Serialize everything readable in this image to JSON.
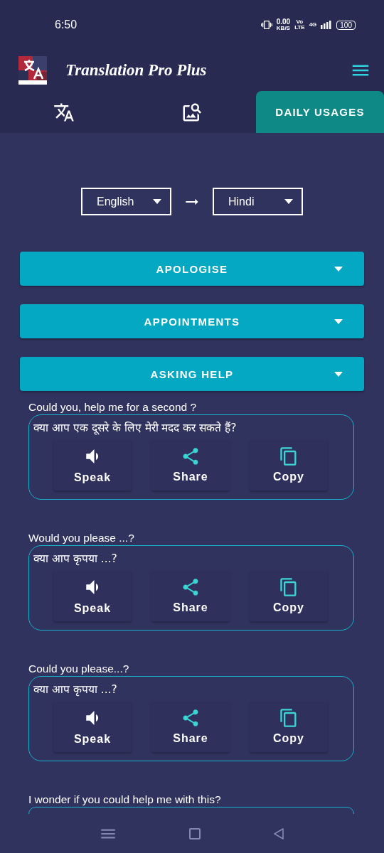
{
  "status_bar": {
    "time": "6:50",
    "speed": "0.00",
    "speed_unit": "KB/S",
    "volte_top": "Vo",
    "volte_bottom": "LTE",
    "network": "4G",
    "battery": "100"
  },
  "app_bar": {
    "title": "Translation Pro Plus"
  },
  "tabs": [
    {
      "kind": "translate",
      "selected": false
    },
    {
      "kind": "image-search",
      "selected": false
    },
    {
      "kind": "text",
      "label": "DAILY USAGES",
      "selected": true
    }
  ],
  "languages": {
    "source": "English",
    "target": "Hindi"
  },
  "categories": [
    {
      "title": "APOLOGISE"
    },
    {
      "title": "APPOINTMENTS"
    },
    {
      "title": "ASKING HELP",
      "phrases": [
        {
          "english": "Could you, help me for a second ?",
          "hindi": "क्या आप एक दूसरे के लिए मेरी मदद कर सकते हैं?",
          "actions": [
            {
              "kind": "speak",
              "label": "Speak"
            },
            {
              "kind": "share",
              "label": "Share"
            },
            {
              "kind": "copy",
              "label": "Copy"
            }
          ]
        },
        {
          "english": "Would you please ...?",
          "hindi": "क्या आप कृपया ...?",
          "actions": [
            {
              "kind": "speak",
              "label": "Speak"
            },
            {
              "kind": "share",
              "label": "Share"
            },
            {
              "kind": "copy",
              "label": "Copy"
            }
          ]
        },
        {
          "english": "Could you please...?",
          "hindi": "क्या आप कृपया ...?",
          "actions": [
            {
              "kind": "speak",
              "label": "Speak"
            },
            {
              "kind": "share",
              "label": "Share"
            },
            {
              "kind": "copy",
              "label": "Copy"
            }
          ]
        },
        {
          "english": "I wonder if you could help me with this?"
        }
      ]
    }
  ]
}
